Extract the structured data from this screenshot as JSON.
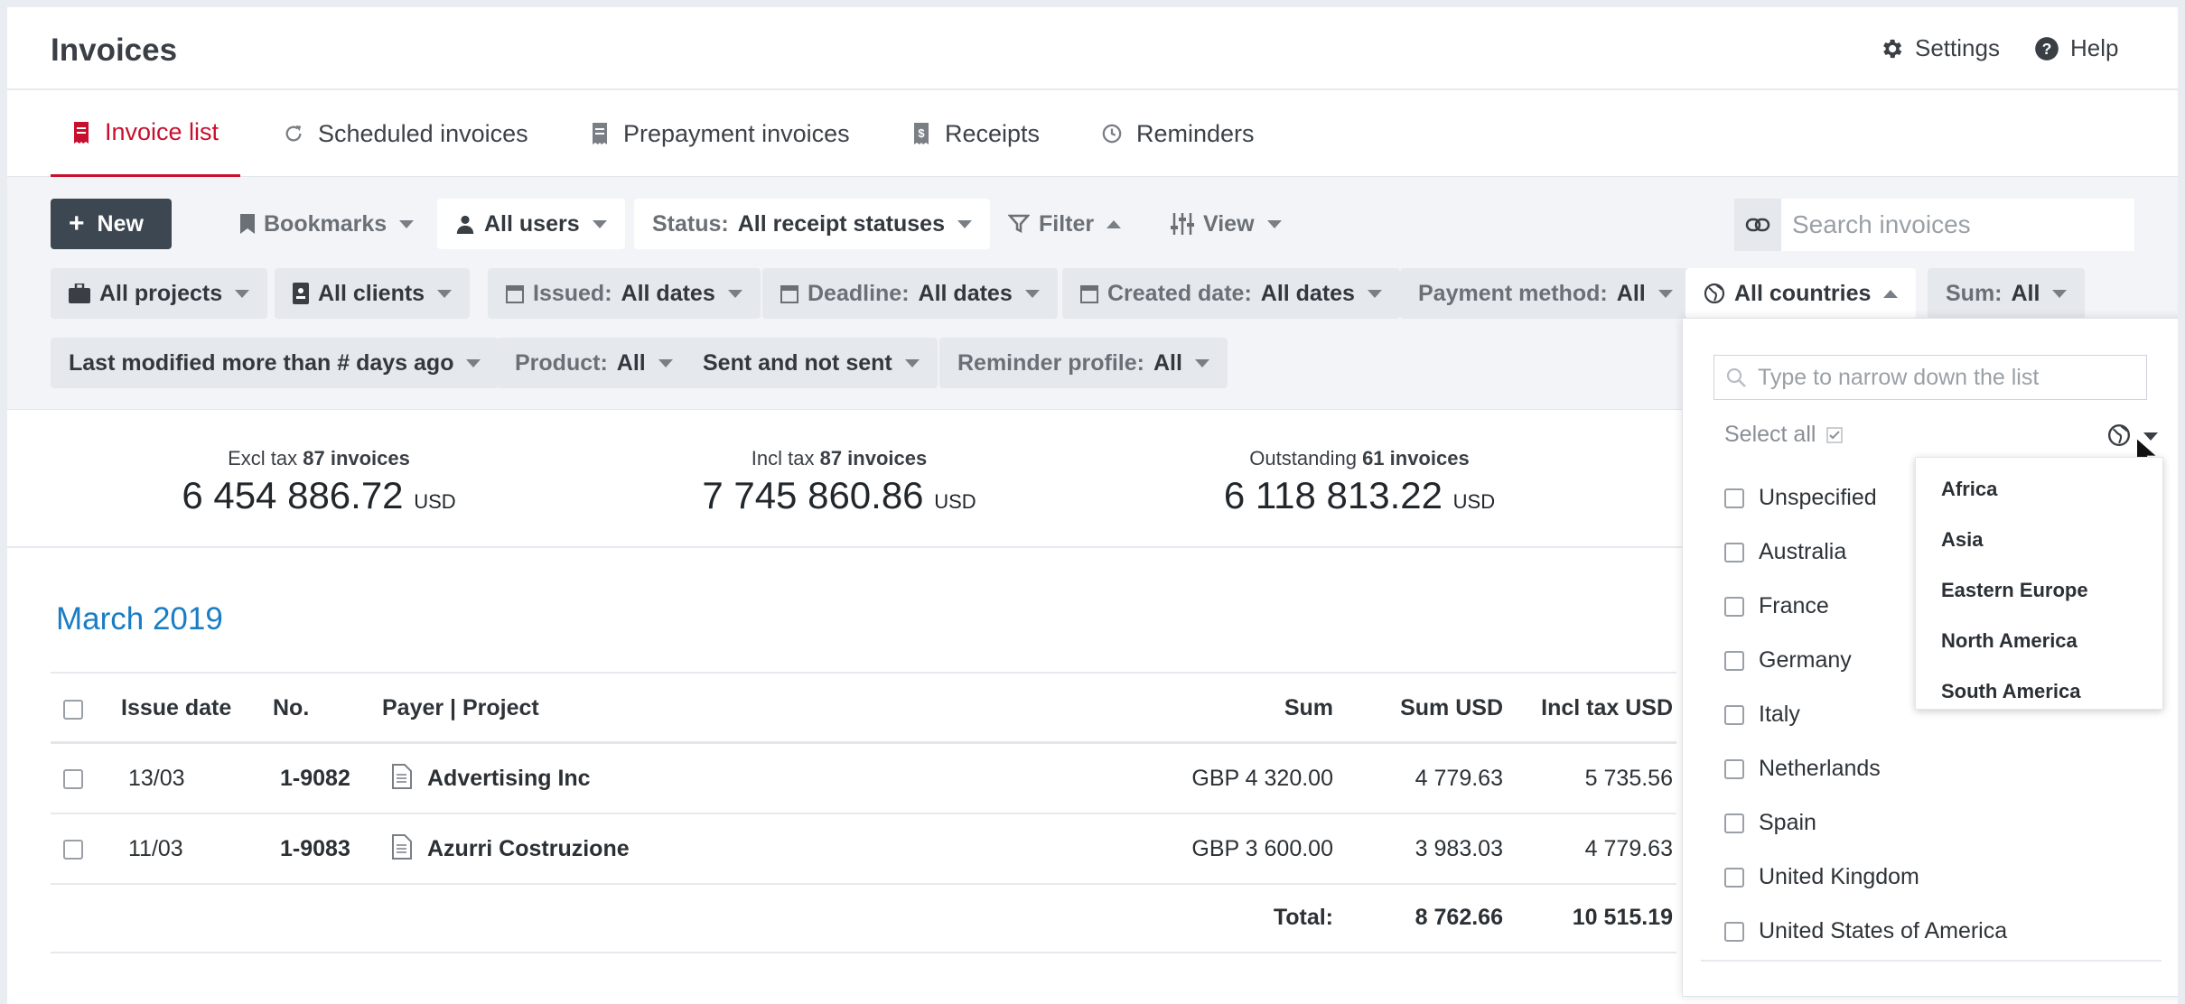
{
  "header": {
    "title": "Invoices",
    "settings": "Settings",
    "help": "Help"
  },
  "tabs": [
    {
      "label": "Invoice list",
      "active": true
    },
    {
      "label": "Scheduled invoices"
    },
    {
      "label": "Prepayment invoices"
    },
    {
      "label": "Receipts"
    },
    {
      "label": "Reminders"
    }
  ],
  "toolbar": {
    "new": "New",
    "bookmarks": "Bookmarks",
    "all_users": "All users",
    "status_label": "Status:",
    "status_value": "All receipt statuses",
    "filter": "Filter",
    "view": "View",
    "search_placeholder": "Search invoices"
  },
  "filters": {
    "all_projects": "All projects",
    "all_clients": "All clients",
    "issued_label": "Issued:",
    "issued_value": "All dates",
    "deadline_label": "Deadline:",
    "deadline_value": "All dates",
    "created_label": "Created date:",
    "created_value": "All dates",
    "payment_label": "Payment method:",
    "payment_value": "All",
    "countries": "All countries",
    "sum_label": "Sum:",
    "sum_value": "All",
    "last_modified": "Last modified more than # days ago",
    "product_label": "Product:",
    "product_value": "All",
    "sent": "Sent and not sent",
    "reminder_label": "Reminder profile:",
    "reminder_value": "All"
  },
  "summary": [
    {
      "caption": "Excl tax",
      "count": "87 invoices",
      "amount": "6 454 886.72",
      "currency": "USD"
    },
    {
      "caption": "Incl tax",
      "count": "87 invoices",
      "amount": "7 745 860.86",
      "currency": "USD"
    },
    {
      "caption": "Outstanding",
      "count": "61 invoices",
      "amount": "6 118 813.22",
      "currency": "USD"
    }
  ],
  "month": "March 2019",
  "table": {
    "headers": {
      "issue_date": "Issue date",
      "no": "No.",
      "payer": "Payer | Project",
      "sum": "Sum",
      "sum_usd": "Sum USD",
      "incl_tax_usd": "Incl tax USD"
    },
    "rows": [
      {
        "date": "13/03",
        "no": "1-9082",
        "payer": "Advertising Inc",
        "sum": "GBP 4 320.00",
        "sum_usd": "4 779.63",
        "incl": "5 735.56"
      },
      {
        "date": "11/03",
        "no": "1-9083",
        "payer": "Azurri Costruzione",
        "sum": "GBP 3 600.00",
        "sum_usd": "3 983.03",
        "incl": "4 779.63"
      }
    ],
    "total_label": "Total:",
    "total_sum_usd": "8 762.66",
    "total_incl": "10 515.19"
  },
  "country_panel": {
    "placeholder": "Type to narrow down the list",
    "select_all": "Select all",
    "countries": [
      "Unspecified",
      "Australia",
      "France",
      "Germany",
      "Italy",
      "Netherlands",
      "Spain",
      "United Kingdom",
      "United States of America"
    ]
  },
  "region_menu": [
    "Africa",
    "Asia",
    "Eastern Europe",
    "North America",
    "South America"
  ],
  "colors": {
    "accent": "#c8102e",
    "link": "#1a7dc4",
    "new_button": "#3c4751"
  }
}
